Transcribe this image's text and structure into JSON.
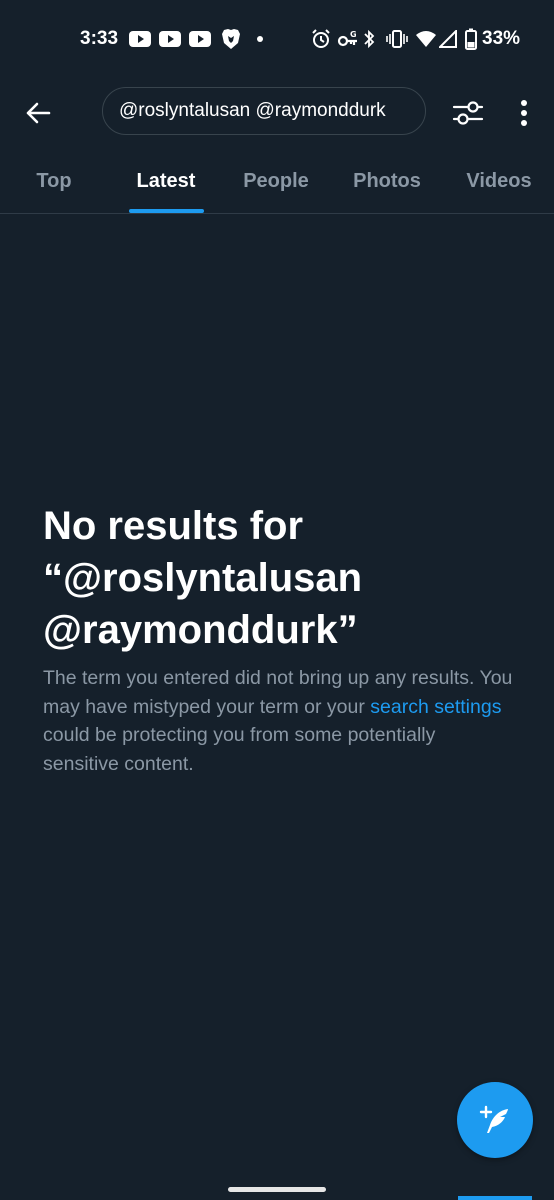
{
  "status_bar": {
    "time": "3:33",
    "battery": "33%",
    "icons": [
      "youtube-icon",
      "youtube-icon",
      "youtube-icon",
      "brave-icon",
      "dot-icon",
      "alarm-icon",
      "vpn-key-icon",
      "bluetooth-icon",
      "vibrate-icon",
      "wifi-icon",
      "signal-icon",
      "battery-icon"
    ]
  },
  "header": {
    "search_query": "@roslyntalusan @raymonddurk",
    "back_icon": "arrow-left-icon",
    "filter_icon": "sliders-icon",
    "more_icon": "more-vertical-icon"
  },
  "tabs": [
    {
      "label": "Top",
      "active": false
    },
    {
      "label": "Latest",
      "active": true
    },
    {
      "label": "People",
      "active": false
    },
    {
      "label": "Photos",
      "active": false
    },
    {
      "label": "Videos",
      "active": false
    }
  ],
  "empty_state": {
    "title": "No results for “@roslyntalusan @raymonddurk”",
    "body_before_link": "The term you entered did not bring up any results. You may have mistyped your term or your ",
    "link_text": "search settings",
    "body_after_link": " could be protecting you from some potentially sensitive content."
  },
  "fab": {
    "icon": "compose-feather-icon"
  },
  "colors": {
    "background": "#15202b",
    "accent": "#1d9bf0",
    "muted_text": "#8b98a5",
    "border": "#38444d"
  }
}
